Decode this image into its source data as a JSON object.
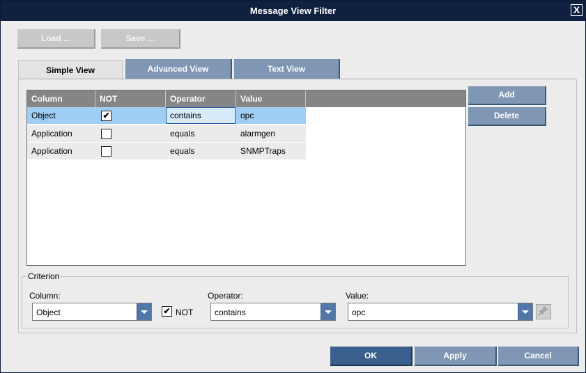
{
  "window": {
    "title": "Message View Filter",
    "close_glyph": "X"
  },
  "toolbar": {
    "load_label": "Load ...",
    "save_label": "Save ..."
  },
  "tabs": [
    {
      "label": "Simple View",
      "active": true
    },
    {
      "label": "Advanced View",
      "active": false
    },
    {
      "label": "Text View",
      "active": false
    }
  ],
  "grid": {
    "headers": [
      "Column",
      "NOT",
      "Operator",
      "Value"
    ],
    "rows": [
      {
        "column": "Object",
        "not": true,
        "operator": "contains",
        "value": "opc",
        "selected": true
      },
      {
        "column": "Application",
        "not": false,
        "operator": "equals",
        "value": "alarmgen",
        "selected": false
      },
      {
        "column": "Application",
        "not": false,
        "operator": "equals",
        "value": "SNMPTraps",
        "selected": false
      }
    ]
  },
  "side_buttons": {
    "add_label": "Add",
    "delete_label": "Delete"
  },
  "criterion": {
    "legend": "Criterion",
    "column_label": "Column:",
    "column_value": "Object",
    "not_label": "NOT",
    "not_checked": true,
    "operator_label": "Operator:",
    "operator_value": "contains",
    "value_label": "Value:",
    "value_value": "opc",
    "value_button_icon": "pin-icon"
  },
  "footer": {
    "ok_label": "OK",
    "apply_label": "Apply",
    "cancel_label": "Cancel"
  },
  "colors": {
    "titlebar": "#0f2040",
    "button_blue": "#7f97b5",
    "button_dark": "#3b5f8c",
    "selection": "#9fcdf3",
    "grid_header": "#858585"
  }
}
